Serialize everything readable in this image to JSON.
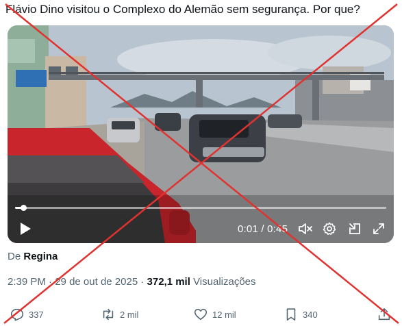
{
  "tweet": {
    "text": "Flávio Dino visitou o Complexo do Alemão sem segurança. Por que?"
  },
  "video": {
    "current_time": "0:01",
    "separator": "/",
    "duration": "0:45",
    "progress_fraction": 0.022,
    "controls": {
      "play_icon": "play-icon",
      "mute_icon": "volume-muted-icon",
      "settings_icon": "gear-icon",
      "pip_icon": "picture-in-picture-icon",
      "fullscreen_icon": "expand-icon"
    }
  },
  "byline": {
    "prefix": "De",
    "name": "Regina"
  },
  "meta": {
    "time": "2:39 PM",
    "sep1": "·",
    "date": "29 de out de 2025",
    "sep2": "·",
    "views_count": "372,1 mil",
    "views_label": "Visualizações"
  },
  "actions": {
    "replies": "337",
    "reposts": "2 mil",
    "likes": "12 mil",
    "bookmarks": "340"
  },
  "colors": {
    "overlay_x": "#e0322f",
    "text_primary": "#0f1419",
    "text_secondary": "#536471"
  }
}
